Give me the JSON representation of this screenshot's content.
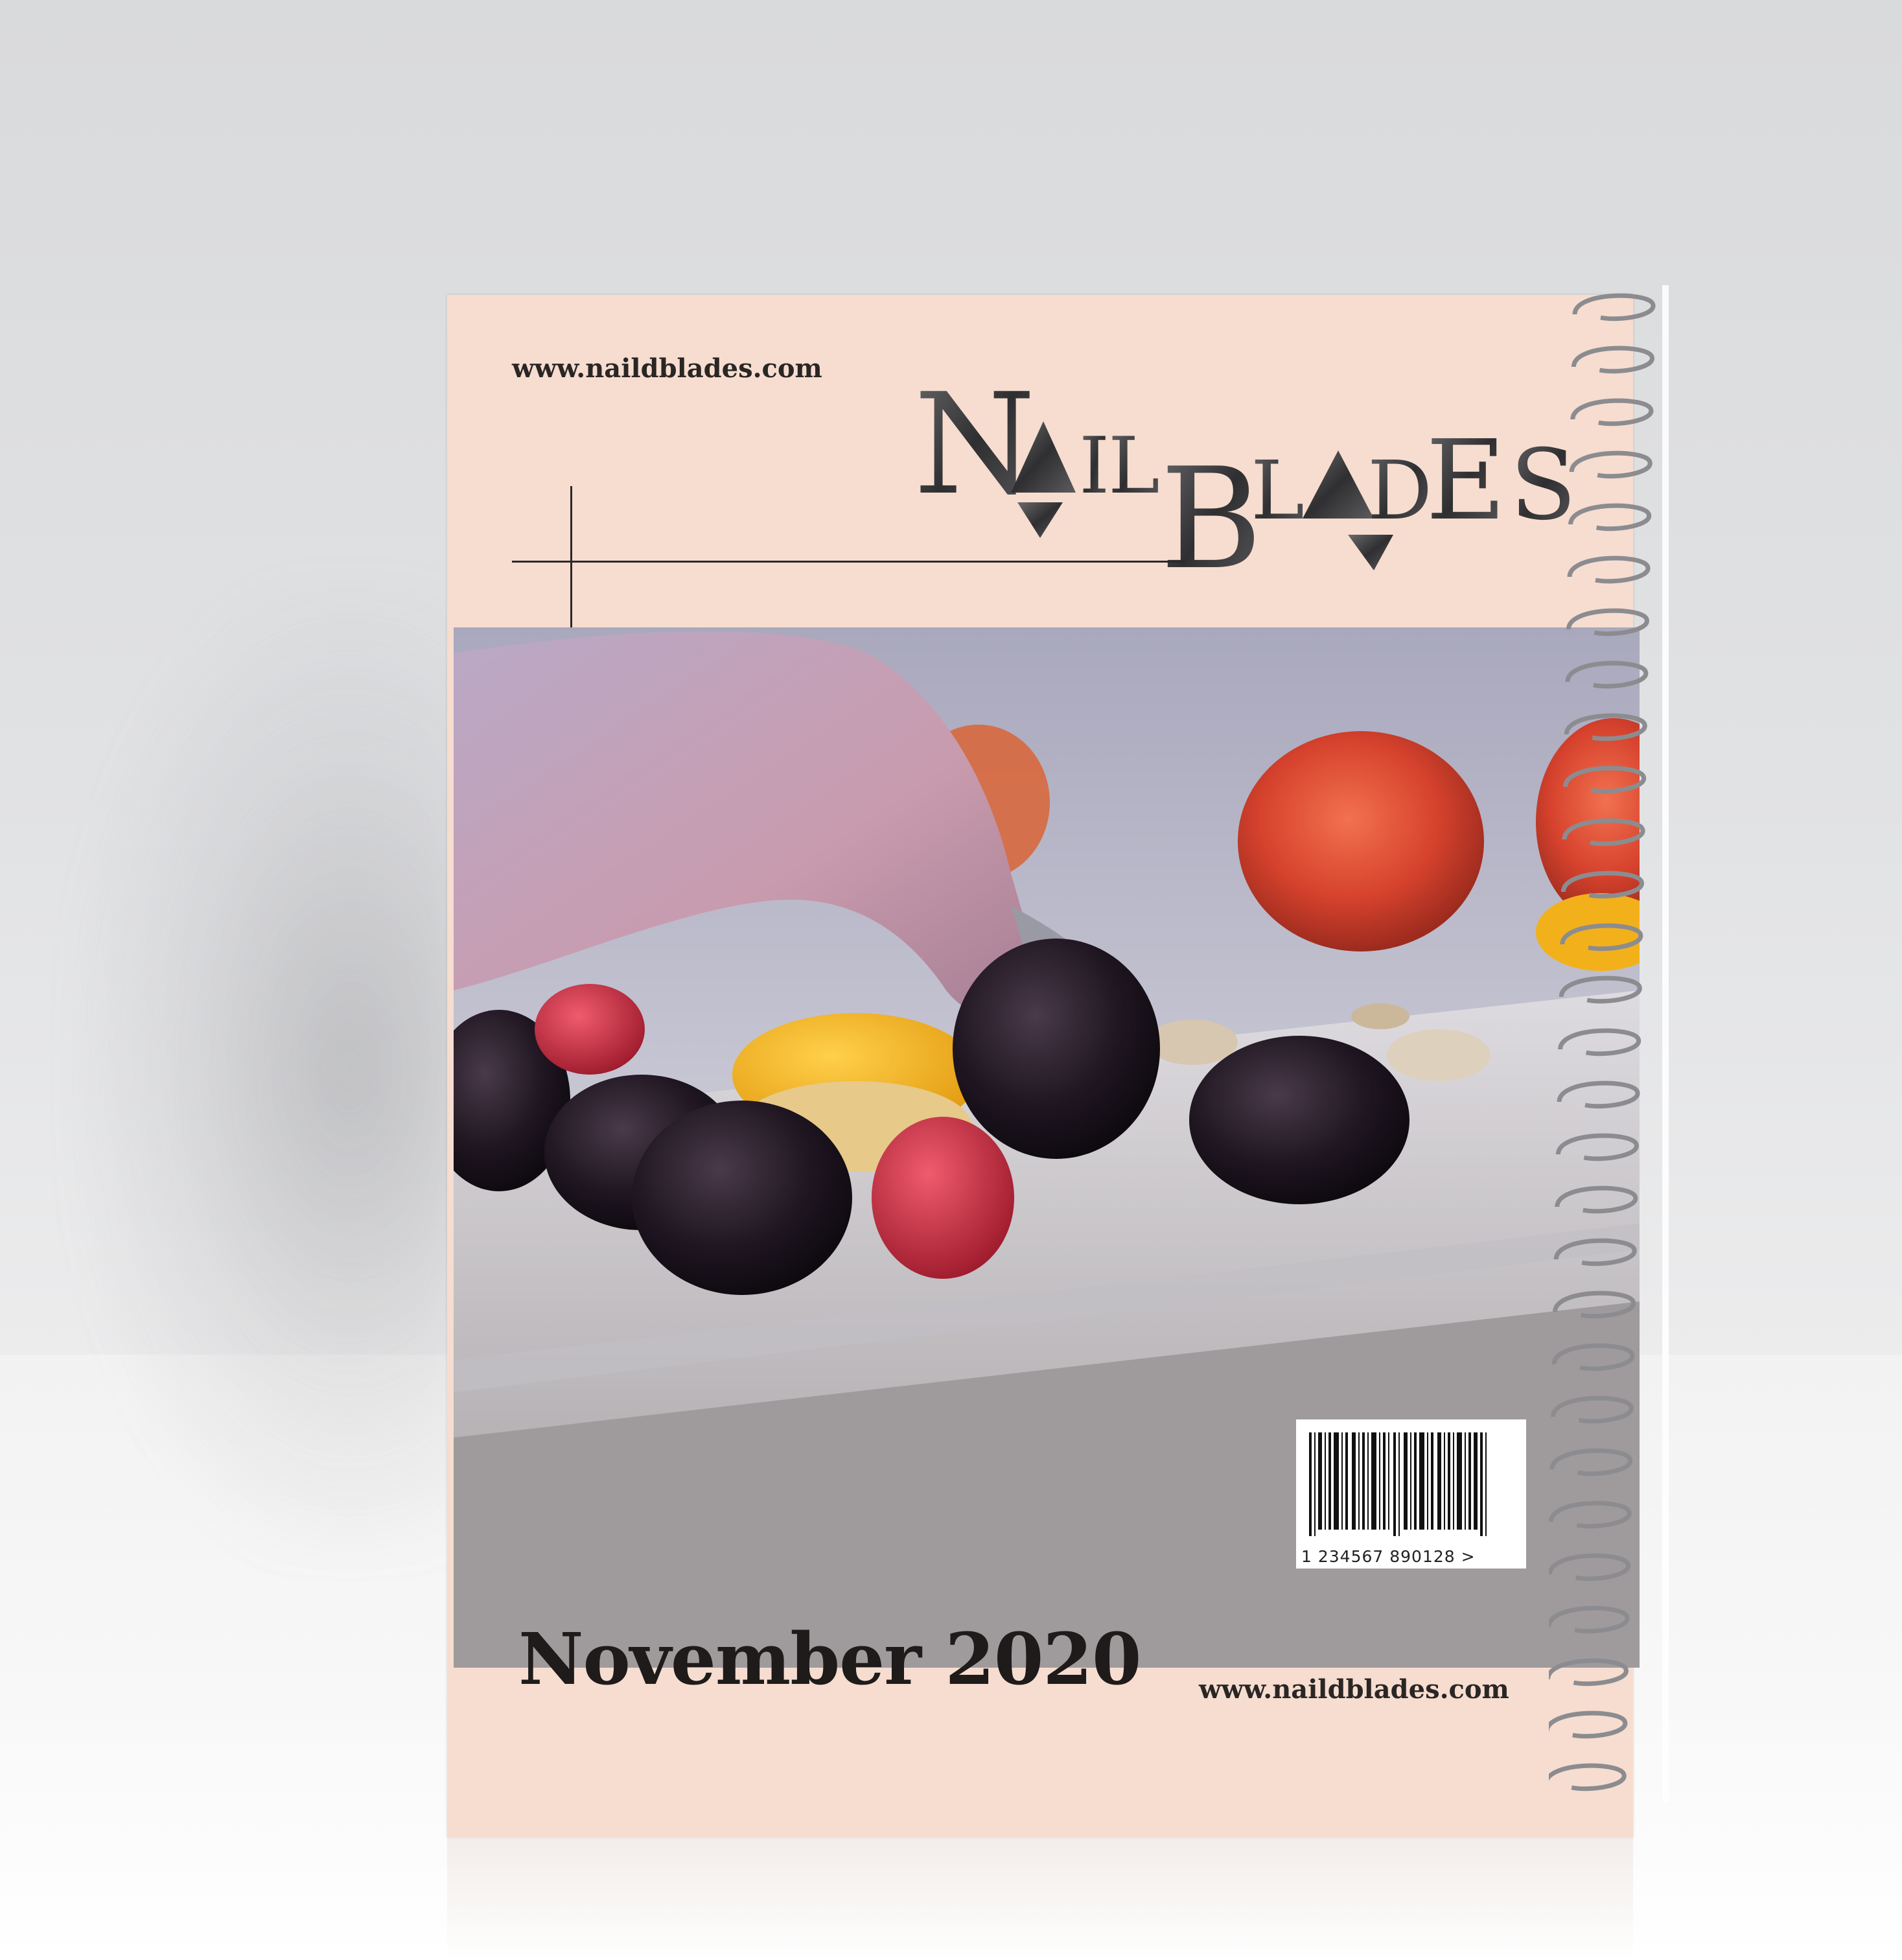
{
  "cover": {
    "url_top": "www.naildblades.com",
    "url_bottom": "www.naildblades.com",
    "brand": "NAILBLADES",
    "issue": "November 2020",
    "barcode_digits": "1 234567 890128 >"
  },
  "colors": {
    "cover_bg": "#f6ddd0",
    "text": "#1e1b1a",
    "brand_metallic": "#4a4a4c"
  }
}
